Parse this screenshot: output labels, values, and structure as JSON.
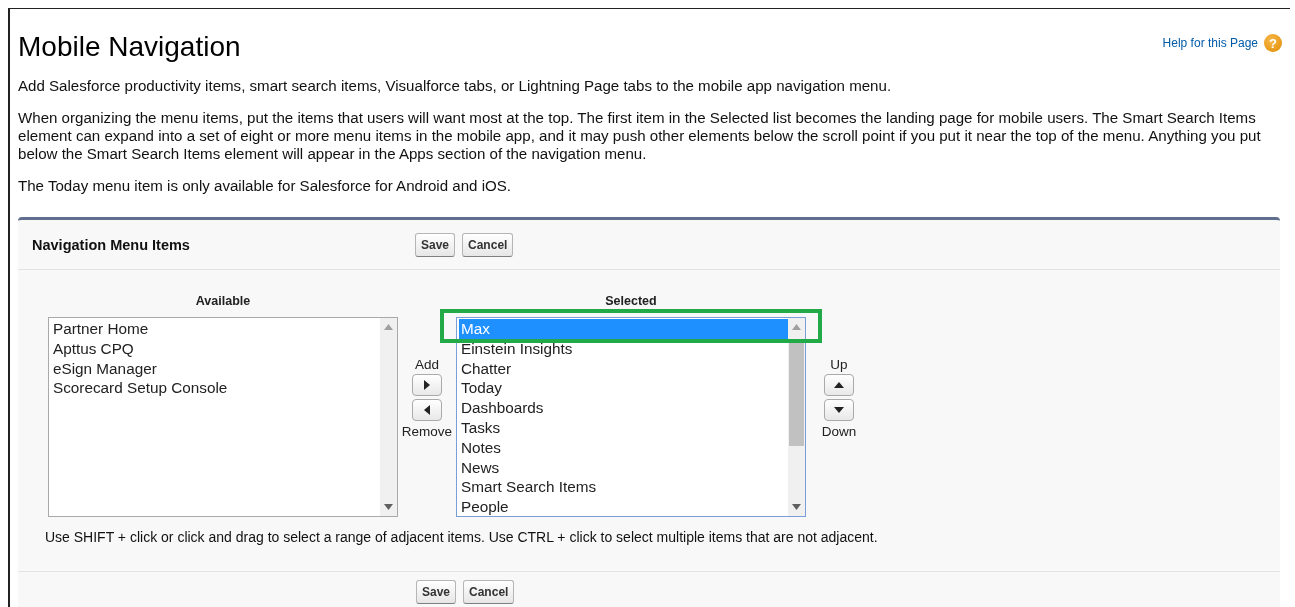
{
  "page": {
    "title": "Mobile Navigation",
    "help_link": "Help for this Page",
    "help_icon": "?"
  },
  "paragraphs": [
    "Add Salesforce productivity items, smart search items, Visualforce tabs, or Lightning Page tabs to the mobile app navigation menu.",
    "When organizing the menu items, put the items that users will want most at the top. The first item in the Selected list becomes the landing page for mobile users. The Smart Search Items element can expand into a set of eight or more menu items in the mobile app, and it may push other elements below the scroll point if you put it near the top of the menu. Anything you put below the Smart Search Items element will appear in the Apps section of the navigation menu.",
    "The Today menu item is only available for Salesforce for Android and iOS."
  ],
  "panel": {
    "title": "Navigation Menu Items",
    "buttons": [
      "Save",
      "Cancel"
    ],
    "available": {
      "label": "Available",
      "items": [
        {
          "label": "Partner Home",
          "selected": false
        },
        {
          "label": "Apttus CPQ",
          "selected": false
        },
        {
          "label": "eSign Manager",
          "selected": false
        },
        {
          "label": "Scorecard Setup Console",
          "selected": false
        }
      ]
    },
    "add_label": "Add",
    "remove_label": "Remove",
    "selected": {
      "label": "Selected",
      "items": [
        {
          "label": "Max",
          "selected": true
        },
        {
          "label": "Einstein Insights",
          "selected": false
        },
        {
          "label": "Chatter",
          "selected": false
        },
        {
          "label": "Today",
          "selected": false
        },
        {
          "label": "Dashboards",
          "selected": false
        },
        {
          "label": "Tasks",
          "selected": false
        },
        {
          "label": "Notes",
          "selected": false
        },
        {
          "label": "News",
          "selected": false
        },
        {
          "label": "Smart Search Items",
          "selected": false
        },
        {
          "label": "People",
          "selected": false
        }
      ]
    },
    "up_label": "Up",
    "down_label": "Down",
    "hint": "Use SHIFT + click or click and drag to select a range of adjacent items. Use CTRL + click to select multiple items that are not adjacent.",
    "footer_buttons": [
      "Save",
      "Cancel"
    ]
  }
}
